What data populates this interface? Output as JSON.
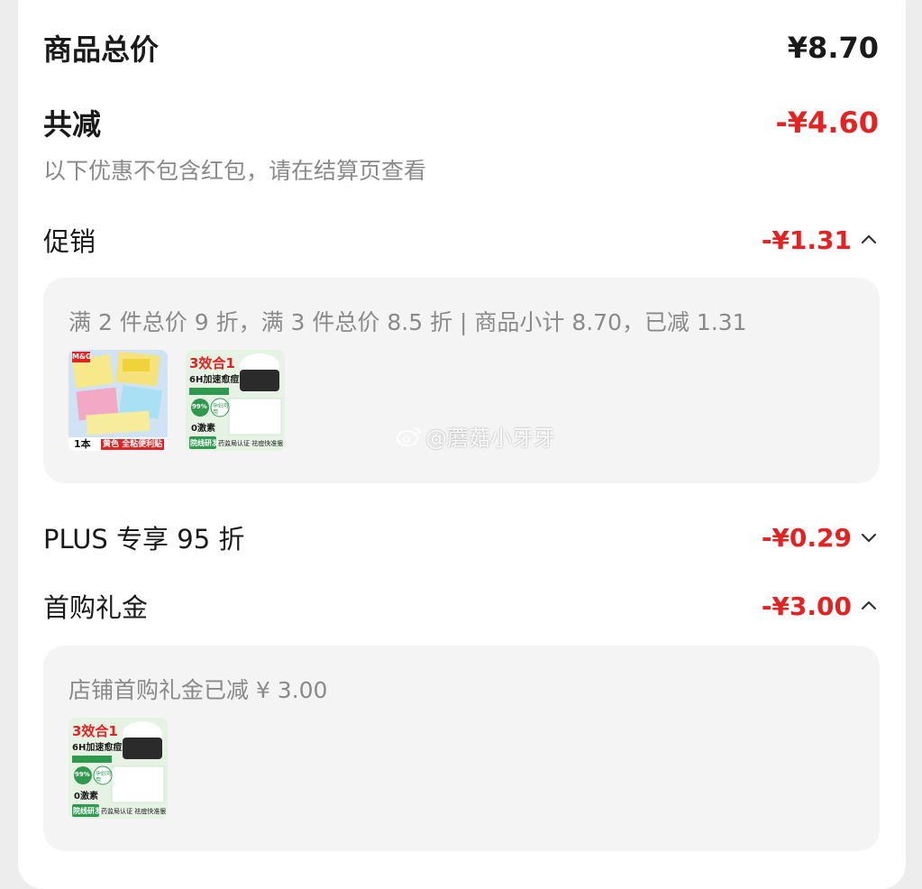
{
  "summary": {
    "total_label": "商品总价",
    "total_value": "¥8.70",
    "discount_label": "共减",
    "discount_value": "-¥4.60",
    "note": "以下优惠不包含红包，请在结算页查看"
  },
  "promotions": [
    {
      "label": "促销",
      "value": "-¥1.31",
      "chevron": "chevron-up-icon",
      "detail": "满 2 件总价 9 折，满 3 件总价 8.5 折 | 商品小计 8.70，已减 1.31"
    },
    {
      "label": "PLUS 专享 95 折",
      "value": "-¥0.29",
      "chevron": "chevron-down-icon"
    },
    {
      "label": "首购礼金",
      "value": "-¥3.00",
      "chevron": "chevron-up-icon",
      "detail": "店铺首购礼金已减 ¥ 3.00"
    }
  ],
  "products": {
    "sticky_notes": {
      "badge": "1本",
      "tag": "黄色 全粘便利贴",
      "logo": "M&G"
    },
    "cream": {
      "headline": "3效合1",
      "subline": "6H加速愈痘",
      "badge_pct": "99%",
      "badge_text": "孕妇可用",
      "zero": "0激素",
      "bottom_tag": "院线研发",
      "bottom_text": "药监局认证 祛痘快准狠"
    }
  },
  "watermark": "@蘑菇小牙牙",
  "colors": {
    "accent_red": "#e52222",
    "text_dark": "#1a1a1a",
    "text_gray": "#8a8a8a",
    "panel_bg": "#f4f4f5",
    "cream_green": "#2f9a4e"
  }
}
